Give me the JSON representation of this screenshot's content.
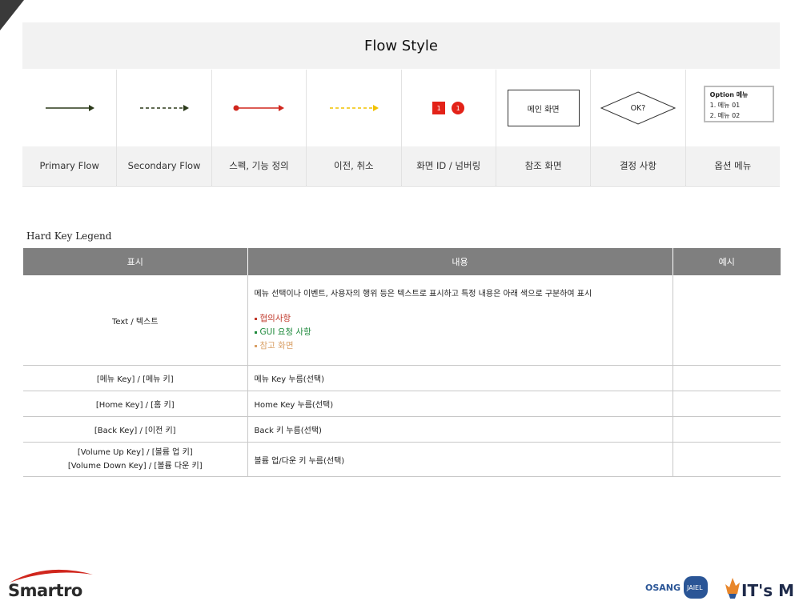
{
  "title": "Flow Style",
  "flows": [
    {
      "caption": "Primary Flow",
      "symbol": "solid-dark-arrow"
    },
    {
      "caption": "Secondary Flow",
      "symbol": "dashed-dark-arrow"
    },
    {
      "caption": "스펙, 기능 정의",
      "symbol": "red-dot-arrow"
    },
    {
      "caption": "이전, 취소",
      "symbol": "yellow-dashed-arrow"
    },
    {
      "caption": "화면 ID / 넘버링",
      "symbol": "red-number-badges",
      "badge_square": "1",
      "badge_circle": "1"
    },
    {
      "caption": "참조 화면",
      "symbol": "main-screen-box",
      "box_label": "메인 화면"
    },
    {
      "caption": "결정 사항",
      "symbol": "decision-diamond",
      "diamond_label": "OK?"
    },
    {
      "caption": "옵션 메뉴",
      "symbol": "option-menu-box",
      "option_title": "Option 메뉴",
      "option_items": [
        "1. 메뉴 01",
        "2. 메뉴 02"
      ]
    }
  ],
  "legend_title": "Hard Key Legend",
  "table": {
    "headers": [
      "표시",
      "내용",
      "예시"
    ],
    "text_row": {
      "display": "Text / 텍스트",
      "description": "메뉴 선택이나 이벤트, 사용자의 행위 등은 텍스트로 표시하고 특정 내용은 아래 색으로 구분하여 표시",
      "bullets": [
        {
          "text": "협의사항",
          "color": "#c0392b"
        },
        {
          "text": "GUI 요청 사항",
          "color": "#1e8a3c"
        },
        {
          "text": "참고 화면",
          "color": "#d9a066"
        }
      ],
      "example": ""
    },
    "rows": [
      {
        "display": "[메뉴 Key] / [메뉴 키]",
        "content": "메뉴 Key 누름(선택)",
        "example": ""
      },
      {
        "display": "[Home Key] / [홈 키]",
        "content": "Home Key 누름(선택)",
        "example": ""
      },
      {
        "display": "[Back Key] / [이전 키]",
        "content": "Back 키 누름(선택)",
        "example": ""
      }
    ],
    "volume_row": {
      "display_line1": "[Volume Up Key] / [볼륨 업 키]",
      "display_line2": "[Volume Down Key] / [볼륨 다운 키]",
      "content": "볼륨 업/다운 키 누름(선택)",
      "example": ""
    }
  },
  "logos": {
    "left": "Smartro",
    "right1_a": "OSANG",
    "right1_b": "JAIEL",
    "right2": "IT's M"
  },
  "colors": {
    "primary_arrow": "#2b3a1a",
    "red_arrow": "#d0261d",
    "yellow_arrow": "#f2c200",
    "header_gray": "#7f7f7f"
  }
}
